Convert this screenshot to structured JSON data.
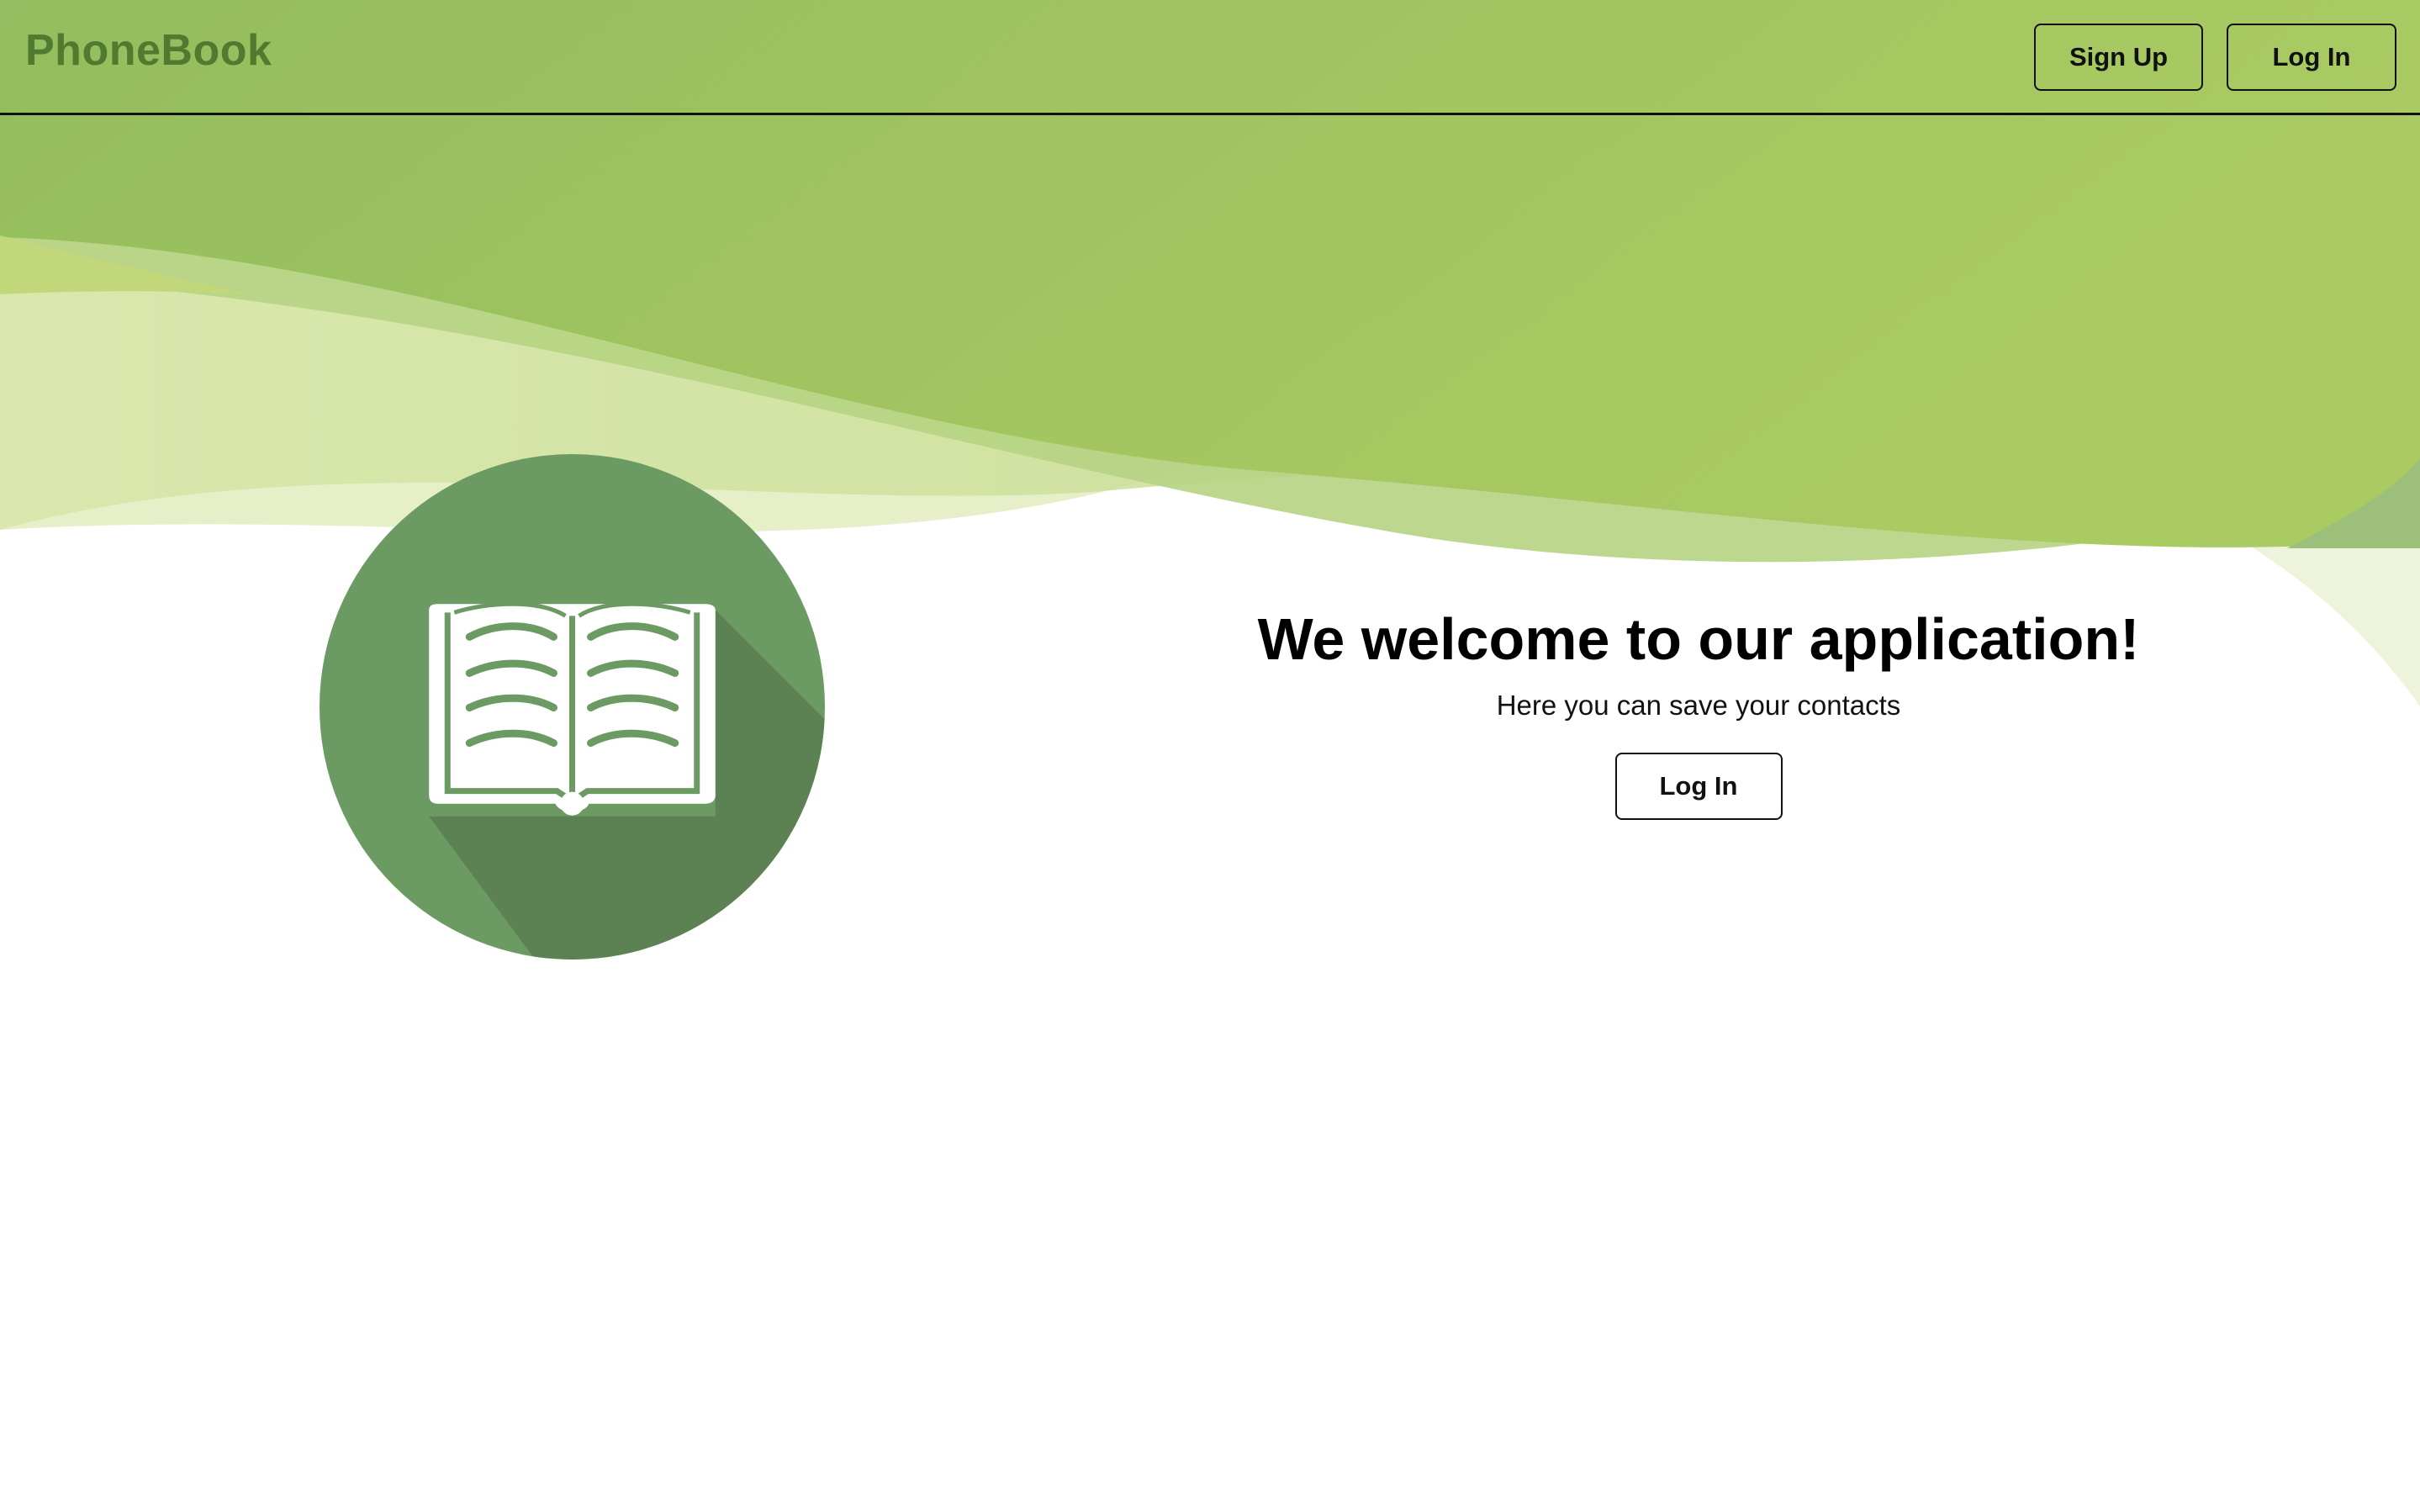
{
  "navbar": {
    "brand": "PhoneBook",
    "signup_label": "Sign Up",
    "login_label": "Log In"
  },
  "hero": {
    "title": "We welcome to our application!",
    "subtitle": "Here you can save your contacts",
    "login_label": "Log In",
    "logo_icon": "open-book-icon"
  },
  "colors": {
    "brand_text": "#4f7a2f",
    "header_green": "#a2c45f",
    "logo_circle": "#6b9a63",
    "logo_shadow": "#5c8253"
  }
}
